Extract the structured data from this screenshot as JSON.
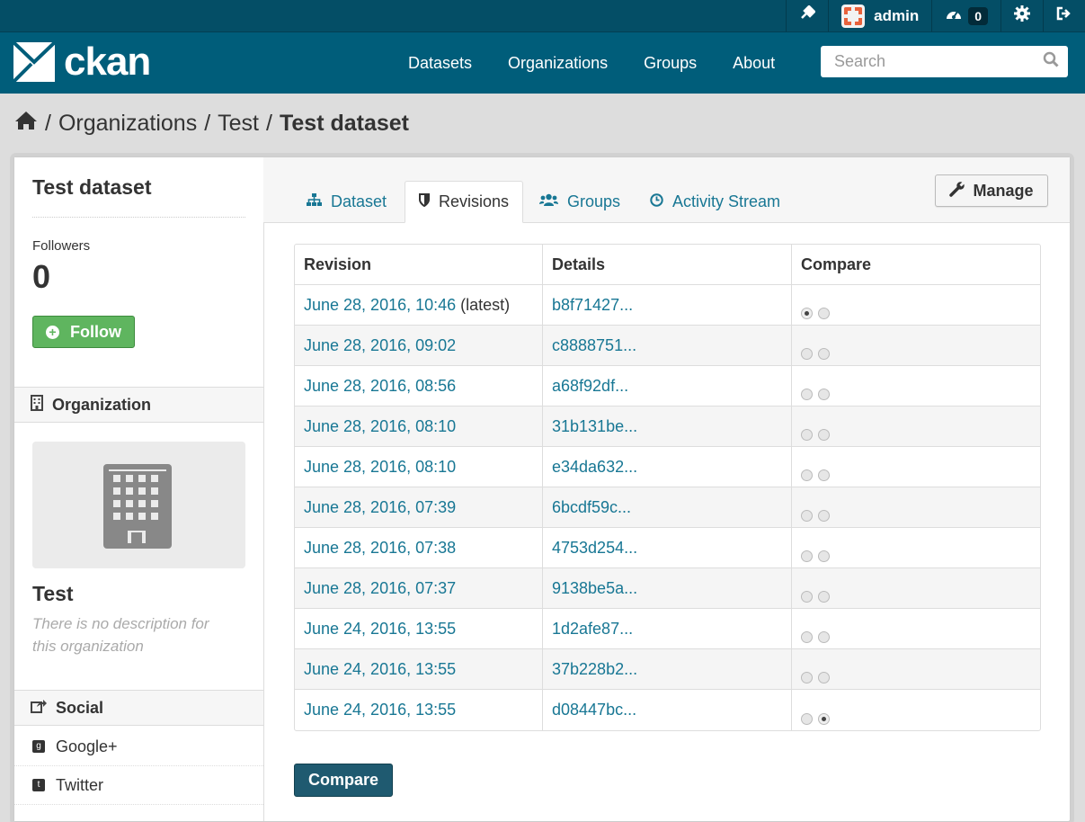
{
  "topbar": {
    "username": "admin",
    "dashboard_count": "0",
    "icons": [
      "gavel-icon",
      "dashboard-icon",
      "gear-icon",
      "sign-out-icon"
    ]
  },
  "masthead": {
    "logo_text": "ckan",
    "nav": [
      "Datasets",
      "Organizations",
      "Groups",
      "About"
    ],
    "search_placeholder": "Search"
  },
  "breadcrumb": {
    "items": [
      "Organizations",
      "Test",
      "Test dataset"
    ]
  },
  "sidebar": {
    "title": "Test dataset",
    "followers_label": "Followers",
    "followers_count": "0",
    "follow_label": "Follow",
    "organization_heading": "Organization",
    "org_name": "Test",
    "org_description": "There is no description for this organization",
    "social_heading": "Social",
    "social_items": [
      "Google+",
      "Twitter"
    ]
  },
  "tabs": {
    "items": [
      "Dataset",
      "Revisions",
      "Groups",
      "Activity Stream"
    ],
    "active": "Revisions",
    "manage_label": "Manage"
  },
  "revisions": {
    "headers": [
      "Revision",
      "Details",
      "Compare"
    ],
    "rows": [
      {
        "date": "June 28, 2016, 10:46",
        "suffix": " (latest)",
        "id": "b8f71427...",
        "left": true,
        "right": false
      },
      {
        "date": "June 28, 2016, 09:02",
        "suffix": "",
        "id": "c8888751...",
        "left": false,
        "right": false
      },
      {
        "date": "June 28, 2016, 08:56",
        "suffix": "",
        "id": "a68f92df...",
        "left": false,
        "right": false
      },
      {
        "date": "June 28, 2016, 08:10",
        "suffix": "",
        "id": "31b131be...",
        "left": false,
        "right": false
      },
      {
        "date": "June 28, 2016, 08:10",
        "suffix": "",
        "id": "e34da632...",
        "left": false,
        "right": false
      },
      {
        "date": "June 28, 2016, 07:39",
        "suffix": "",
        "id": "6bcdf59c...",
        "left": false,
        "right": false
      },
      {
        "date": "June 28, 2016, 07:38",
        "suffix": "",
        "id": "4753d254...",
        "left": false,
        "right": false
      },
      {
        "date": "June 28, 2016, 07:37",
        "suffix": "",
        "id": "9138be5a...",
        "left": false,
        "right": false
      },
      {
        "date": "June 24, 2016, 13:55",
        "suffix": "",
        "id": "1d2afe87...",
        "left": false,
        "right": false
      },
      {
        "date": "June 24, 2016, 13:55",
        "suffix": "",
        "id": "37b228b2...",
        "left": false,
        "right": false
      },
      {
        "date": "June 24, 2016, 13:55",
        "suffix": "",
        "id": "d08447bc...",
        "left": false,
        "right": true
      }
    ],
    "compare_label": "Compare"
  },
  "colors": {
    "masthead": "#005d7a",
    "topbar": "#044e66",
    "link": "#187794",
    "follow": "#5fb55f",
    "compare_button": "#1f5a70"
  }
}
